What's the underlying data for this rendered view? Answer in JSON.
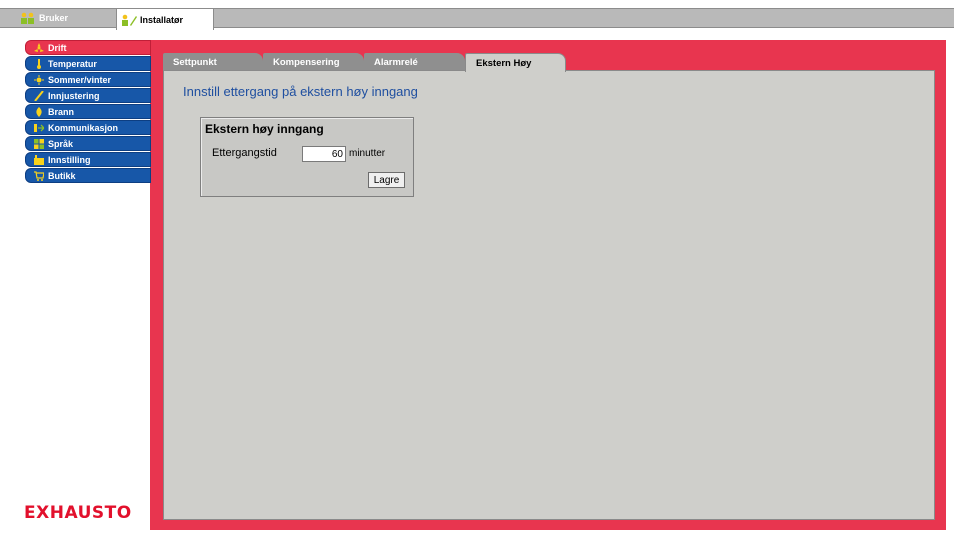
{
  "top_tabs": [
    {
      "label": "Bruker",
      "icon": "users-icon",
      "active": false
    },
    {
      "label": "Installatør",
      "icon": "installer-icon",
      "active": true
    }
  ],
  "sidebar": {
    "items": [
      {
        "label": "Drift",
        "icon": "fan-icon",
        "active": true
      },
      {
        "label": "Temperatur",
        "icon": "thermometer-icon",
        "active": false
      },
      {
        "label": "Sommer/vinter",
        "icon": "sun-icon",
        "active": false
      },
      {
        "label": "Innjustering",
        "icon": "adjust-icon",
        "active": false
      },
      {
        "label": "Brann",
        "icon": "fire-icon",
        "active": false
      },
      {
        "label": "Kommunikasjon",
        "icon": "communication-icon",
        "active": false
      },
      {
        "label": "Språk",
        "icon": "language-icon",
        "active": false
      },
      {
        "label": "Innstilling",
        "icon": "settings-icon",
        "active": false
      },
      {
        "label": "Butikk",
        "icon": "cart-icon",
        "active": false
      }
    ]
  },
  "logo": "EXHAUSTO",
  "sub_tabs": [
    {
      "label": "Settpunkt",
      "active": false
    },
    {
      "label": "Kompensering",
      "active": false
    },
    {
      "label": "Alarmrelé",
      "active": false
    },
    {
      "label": "Ekstern Høy",
      "active": true
    }
  ],
  "main": {
    "heading": "Innstill ettergang på ekstern høy inngang",
    "box": {
      "title": "Ekstern høy inngang",
      "field_label": "Ettergangstid",
      "field_value": "60",
      "unit": "minutter",
      "save_label": "Lagre"
    }
  },
  "colors": {
    "accent_red": "#e8354f",
    "nav_blue": "#1757a8",
    "heading_blue": "#1f4fa0",
    "panel_gray": "#cfcfcb",
    "logo_red": "#e2102c"
  }
}
